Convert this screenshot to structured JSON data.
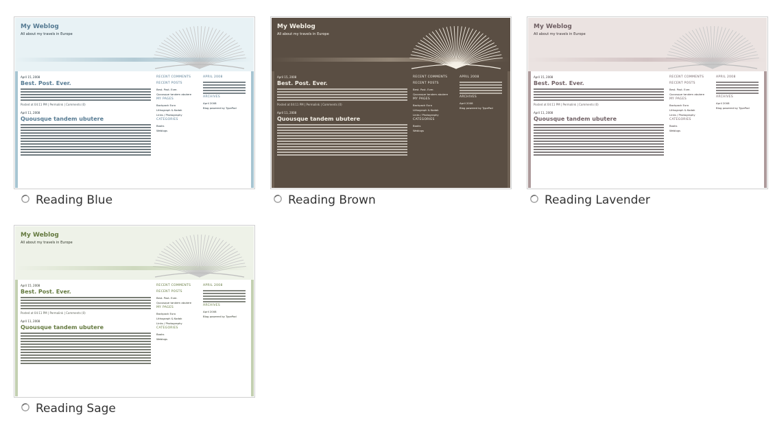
{
  "themes": [
    {
      "label": "Reading Blue",
      "colors": {
        "bg": "#ffffff",
        "header": "#e8f2f5",
        "title": "#557a92",
        "text": "#22323a",
        "accent": "#8fb0bf",
        "side": "#a7c5d2"
      },
      "preview": {
        "blog_title": "My Weblog",
        "blog_subtitle": "All about my travels in Europe",
        "post1_title": "Best. Post. Ever.",
        "post2_title": "Quousque tandem ubutere",
        "sidebar": {
          "recent_comments": "RECENT COMMENTS",
          "recent_posts": "RECENT POSTS",
          "my_pages": "MY PAGES",
          "categories": "CATEGORIES",
          "month": "APRIL 2008",
          "archives": "ARCHIVES",
          "powered": "Blog powered by TypePad"
        }
      }
    },
    {
      "label": "Reading Brown",
      "colors": {
        "bg": "#5a4e43",
        "header": "#5a4e43",
        "title": "#f3efe6",
        "text": "#f7f3eb",
        "accent": "#b9ab99",
        "side": "#6f6255"
      },
      "preview": {
        "blog_title": "My Weblog",
        "blog_subtitle": "All about my travels in Europe",
        "post1_title": "Best. Post. Ever.",
        "post2_title": "Quousque tandem ubutere",
        "sidebar": {
          "recent_comments": "RECENT COMMENTS",
          "recent_posts": "RECENT POSTS",
          "my_pages": "MY PAGES",
          "categories": "CATEGORIES",
          "month": "APRIL 2008",
          "archives": "ARCHIVES",
          "powered": "Blog powered by TypePad"
        }
      }
    },
    {
      "label": "Reading Lavender",
      "colors": {
        "bg": "#ffffff",
        "header": "#ebe3e1",
        "title": "#6f5f63",
        "text": "#3a3234",
        "accent": "#c2aeb0",
        "side": "#ad9a9b"
      },
      "preview": {
        "blog_title": "My Weblog",
        "blog_subtitle": "All about my travels in Europe",
        "post1_title": "Best. Post. Ever.",
        "post2_title": "Quousque tandem ubutere",
        "sidebar": {
          "recent_comments": "RECENT COMMENTS",
          "recent_posts": "RECENT POSTS",
          "my_pages": "MY PAGES",
          "categories": "CATEGORIES",
          "month": "APRIL 2008",
          "archives": "ARCHIVES",
          "powered": "Blog powered by TypePad"
        }
      }
    },
    {
      "label": "Reading Sage",
      "colors": {
        "bg": "#ffffff",
        "header": "#eef2e8",
        "title": "#64793f",
        "text": "#2f3528",
        "accent": "#b8c8a2",
        "side": "#c3d0b1"
      },
      "preview": {
        "blog_title": "My Weblog",
        "blog_subtitle": "All about my travels in Europe",
        "post1_title": "Best. Post. Ever.",
        "post2_title": "Quousque tandem ubutere",
        "sidebar": {
          "recent_comments": "RECENT COMMENTS",
          "recent_posts": "RECENT POSTS",
          "my_pages": "MY PAGES",
          "categories": "CATEGORIES",
          "month": "APRIL 2008",
          "archives": "ARCHIVES",
          "powered": "Blog powered by TypePad"
        }
      }
    }
  ],
  "radio_icon": "radio-button-unchecked-icon"
}
